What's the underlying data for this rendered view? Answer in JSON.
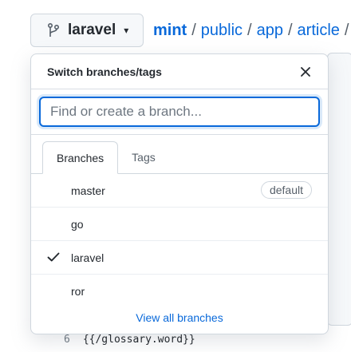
{
  "branch_selector": {
    "label": "laravel"
  },
  "breadcrumb": {
    "repo": "mint",
    "segments": [
      "public",
      "app",
      "article"
    ],
    "separator": "/"
  },
  "popover": {
    "title": "Switch branches/tags",
    "filter_placeholder": "Find or create a branch...",
    "tabs": [
      "Branches",
      "Tags"
    ],
    "active_tab": "Branches",
    "branches": [
      {
        "name": "master",
        "badge": "default",
        "selected": false
      },
      {
        "name": "go",
        "badge": "",
        "selected": false
      },
      {
        "name": "laravel",
        "badge": "",
        "selected": true
      },
      {
        "name": "ror",
        "badge": "",
        "selected": false
      }
    ],
    "view_all_label": "View all branches"
  },
  "code": {
    "line_number": "6",
    "text": "{{/glossary.word}}"
  },
  "icons": {
    "branch": "git-branch-icon",
    "caret": "caret-down-icon",
    "close": "close-icon",
    "check": "check-icon"
  },
  "colors": {
    "accent": "#0969da",
    "border": "#d0d7de"
  }
}
